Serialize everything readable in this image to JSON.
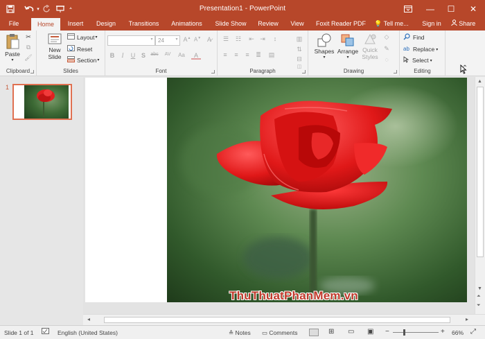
{
  "titlebar": {
    "title": "Presentation1 - PowerPoint",
    "save_icon": "save-icon",
    "undo_icon": "undo-icon",
    "redo_icon": "redo-icon",
    "customize_icon": "customize-quick-access-icon",
    "ribbon_options_icon": "ribbon-display-options-icon",
    "minimize_glyph": "—",
    "restore_glyph": "☐",
    "close_glyph": "✕",
    "bg_color": "#b7472a"
  },
  "tabs": [
    "File",
    "Home",
    "Insert",
    "Design",
    "Transitions",
    "Animations",
    "Slide Show",
    "Review",
    "View",
    "Foxit Reader PDF"
  ],
  "tell_me": "Tell me...",
  "sign_in": "Sign in",
  "share": "Share",
  "ribbon": {
    "clipboard": {
      "label": "Clipboard",
      "paste": "Paste"
    },
    "slides": {
      "label": "Slides",
      "new_slide_1": "New",
      "new_slide_2": "Slide",
      "layout": "Layout",
      "reset": "Reset",
      "section": "Section"
    },
    "font": {
      "label": "Font",
      "font_name": "",
      "font_size": "24",
      "bold": "B",
      "italic": "I",
      "underline": "U",
      "strike": "S",
      "shadow": "abc",
      "spacing": "AV",
      "case": "Aa"
    },
    "paragraph": {
      "label": "Paragraph"
    },
    "drawing": {
      "label": "Drawing",
      "shapes": "Shapes",
      "arrange": "Arrange",
      "quick_styles_1": "Quick",
      "quick_styles_2": "Styles"
    },
    "editing": {
      "label": "Editing",
      "find": "Find",
      "replace": "Replace",
      "select": "Select"
    }
  },
  "thumbnails": [
    {
      "number": "1"
    }
  ],
  "watermark": "ThuThuatPhanMem.vn",
  "status": {
    "slide": "Slide 1 of 1",
    "language": "English (United States)",
    "notes": "Notes",
    "comments": "Comments",
    "zoom": "66%",
    "minus": "−",
    "plus": "+"
  }
}
